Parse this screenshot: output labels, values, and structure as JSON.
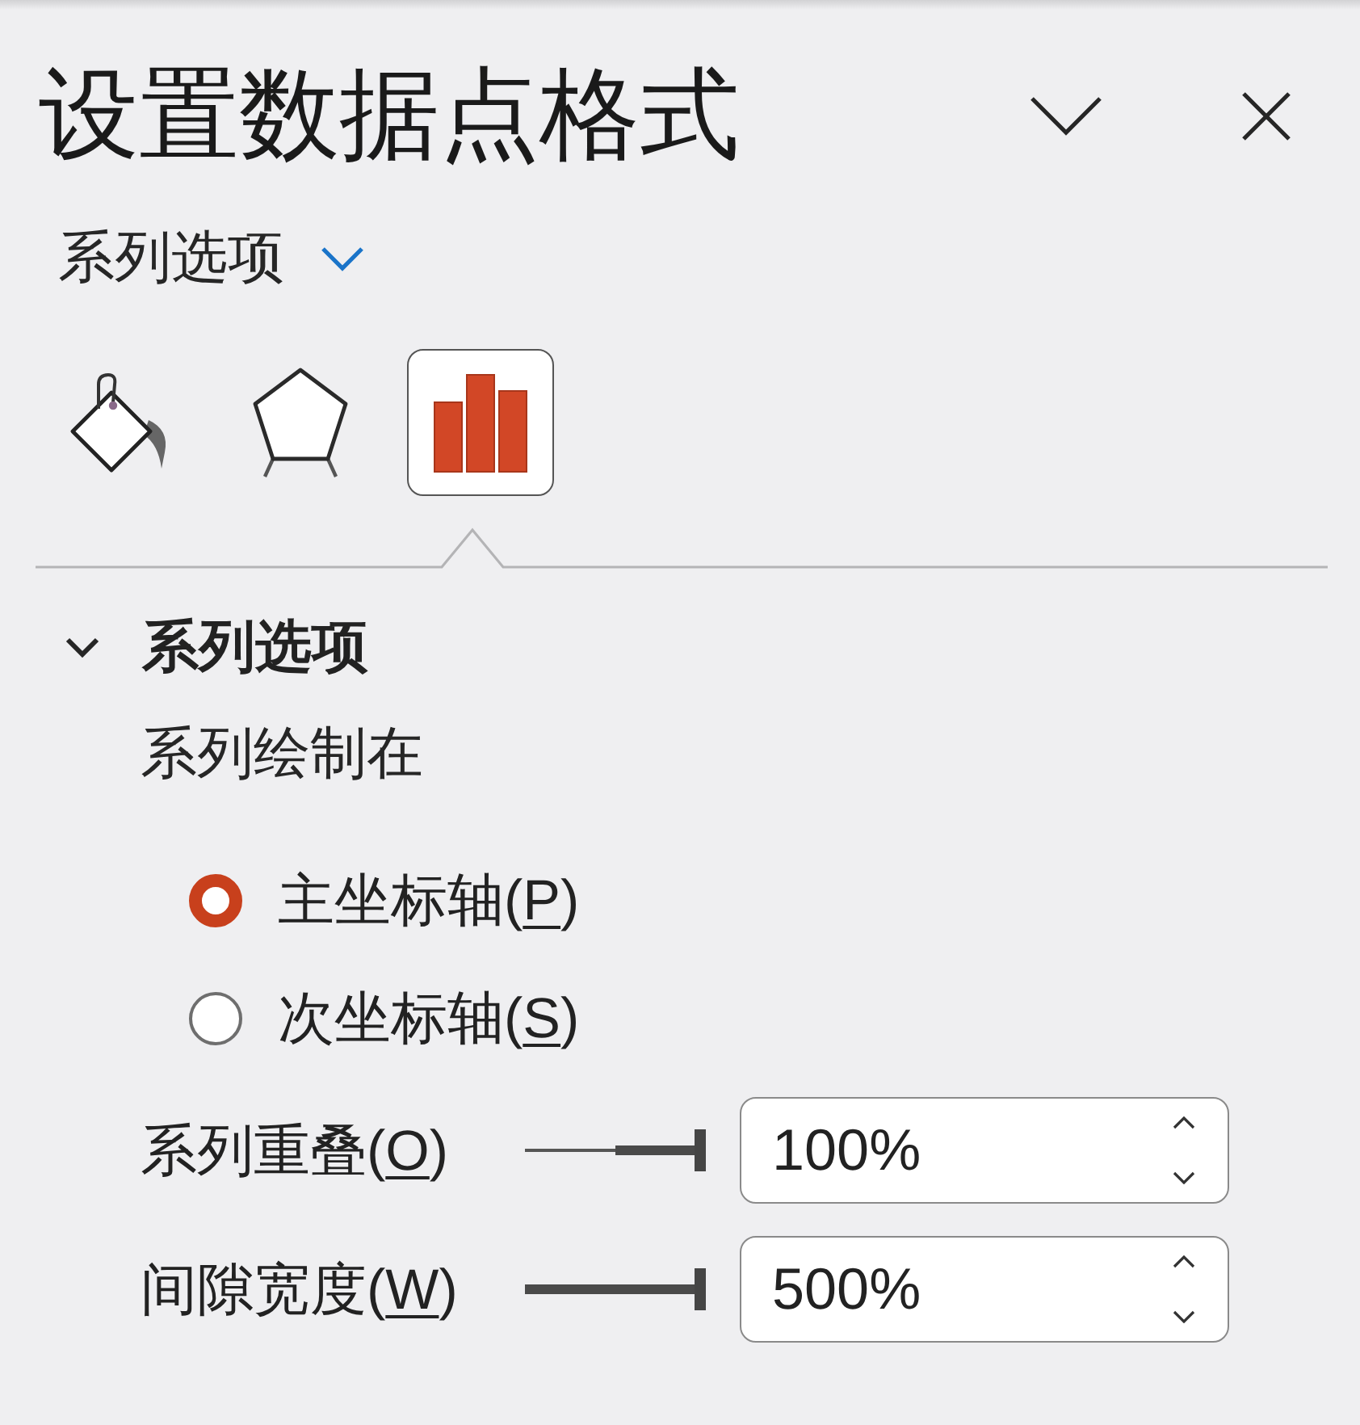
{
  "pane": {
    "title": "设置数据点格式"
  },
  "options_dropdown": {
    "label": "系列选项"
  },
  "tabs": [
    {
      "kind": "fill_line",
      "selected": false
    },
    {
      "kind": "effects",
      "selected": false
    },
    {
      "kind": "series_options",
      "selected": true
    }
  ],
  "section": {
    "title": "系列选项",
    "expanded": true,
    "plot_on_label": "系列绘制在",
    "axis_options": [
      {
        "label": "主坐标轴(",
        "access_key": "P",
        "label_end": ")",
        "selected": true
      },
      {
        "label": "次坐标轴(",
        "access_key": "S",
        "label_end": ")",
        "selected": false
      }
    ],
    "settings": [
      {
        "label": "系列重叠(",
        "access_key": "O",
        "label_end": ")",
        "kind": "bipolar",
        "level": 1,
        "value": "100%"
      },
      {
        "label": "间隙宽度(",
        "access_key": "W",
        "label_end": ")",
        "kind": "plain",
        "level": 1,
        "value": "500%"
      }
    ]
  }
}
